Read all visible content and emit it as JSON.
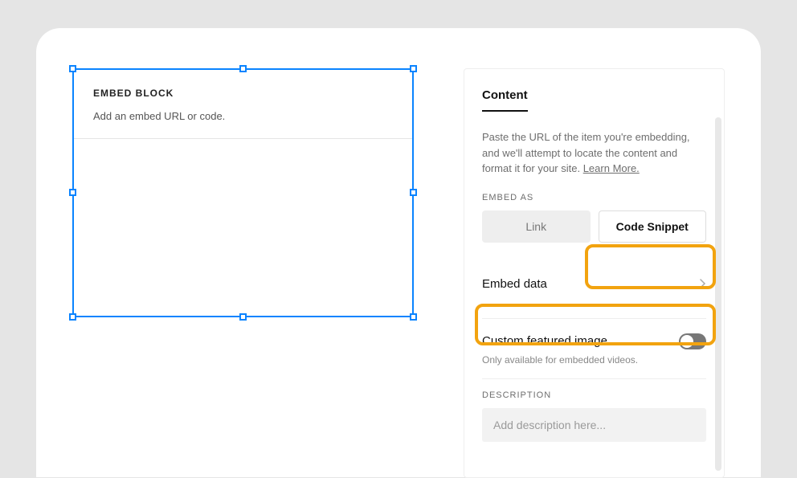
{
  "canvas": {
    "block_title": "EMBED BLOCK",
    "block_desc": "Add an embed URL or code."
  },
  "panel": {
    "tab": "Content",
    "help_prefix": "Paste the URL of the item you're embedding, and we'll attempt to locate the content and format it for your site. ",
    "learn_more": "Learn More.",
    "embed_as_label": "EMBED AS",
    "seg_link": "Link",
    "seg_code": "Code Snippet",
    "embed_data_label": "Embed data",
    "featured_label": "Custom featured image",
    "featured_help": "Only available for embedded videos.",
    "description_label": "DESCRIPTION",
    "description_placeholder": "Add description here..."
  }
}
